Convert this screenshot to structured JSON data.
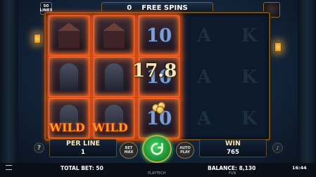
{
  "header": {
    "free_spins_count": "0",
    "free_spins_label": "FREE SPINS",
    "lines_badge": {
      "number": "50",
      "label": "LINES"
    }
  },
  "reels": [
    [
      "wild-house",
      "wild-ghost",
      "wild-ghost"
    ],
    [
      "wild-house",
      "wild-ghost",
      "wild-ghost"
    ],
    [
      "10",
      "10",
      "10"
    ],
    [
      "A",
      "A",
      "A"
    ],
    [
      "K",
      "K",
      "K"
    ]
  ],
  "symbols": {
    "ten": "10",
    "ace": "A",
    "king": "K"
  },
  "win_popup": "17.8",
  "wild_labels": [
    "WILD",
    "WILD"
  ],
  "per_line": {
    "label": "PER LINE",
    "value": "1"
  },
  "win": {
    "label": "WIN",
    "value": "765"
  },
  "buttons": {
    "help": "?",
    "bet_max": "BET MAX",
    "auto_play": "AUTO PLAY",
    "sound": "♪"
  },
  "footer": {
    "total_bet": "TOTAL BET: 50",
    "balance": "BALANCE: 8,130",
    "mode": "FUN",
    "time": "16:44",
    "provider": "PLAYTECH"
  },
  "colors": {
    "spin_green": "#1e9a3a",
    "frame_gold": "#7a5a25",
    "wild_orange": "#ff9a2a"
  }
}
